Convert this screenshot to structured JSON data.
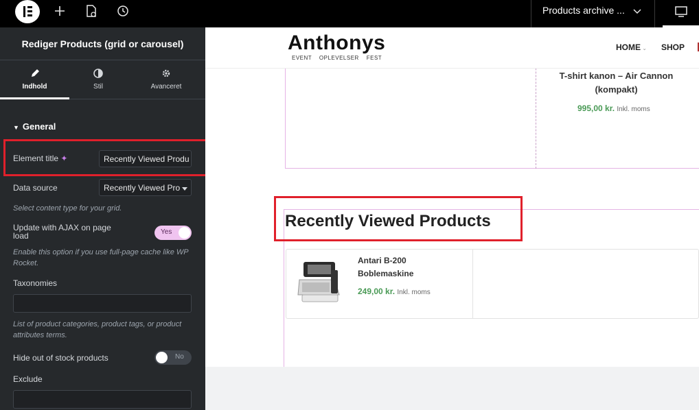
{
  "topbar": {
    "page_selector": "Products archive ...",
    "icons": [
      "elementor-logo-icon",
      "plus-icon",
      "page-settings-icon",
      "history-icon",
      "chevron-down-icon",
      "desktop-icon"
    ]
  },
  "panel": {
    "title": "Rediger Products (grid or carousel)",
    "tabs": [
      {
        "label": "Indhold",
        "icon": "pencil-icon",
        "active": true
      },
      {
        "label": "Stil",
        "icon": "half-circle-icon",
        "active": false
      },
      {
        "label": "Avanceret",
        "icon": "gear-icon",
        "active": false
      }
    ],
    "section": "General",
    "element_title": {
      "label": "Element title",
      "value": "Recently Viewed Produ"
    },
    "data_source": {
      "label": "Data source",
      "value": "Recently Viewed Pro",
      "help": "Select content type for your grid."
    },
    "ajax": {
      "label": "Update with AJAX on page load",
      "state": "Yes",
      "help": "Enable this option if you use full-page cache like WP Rocket."
    },
    "taxonomies": {
      "label": "Taxonomies",
      "value": "",
      "help": "List of product categories, product tags, or product attributes terms."
    },
    "hide_stock": {
      "label": "Hide out of stock products",
      "state": "No"
    },
    "exclude": {
      "label": "Exclude",
      "value": ""
    }
  },
  "site": {
    "brand": "Anthonys",
    "tagline": "EVENT    OPLEVELSER    FEST",
    "nav": [
      "HOME",
      "SHOP"
    ],
    "top_product": {
      "title": "T-shirt kanon – Air Cannon (kompakt)",
      "price": "995,00 kr.",
      "tax_note": "Inkl. moms"
    },
    "recently_viewed": {
      "heading": "Recently Viewed Products",
      "items": [
        {
          "title": "Antari B-200 Boblemaskine",
          "price": "249,00 kr.",
          "tax_note": "Inkl. moms"
        }
      ]
    }
  },
  "colors": {
    "accent_pink": "#f0c4f0",
    "price_green": "#4a9a56",
    "highlight_red": "#e0202b",
    "panel_bg": "#26292c"
  }
}
